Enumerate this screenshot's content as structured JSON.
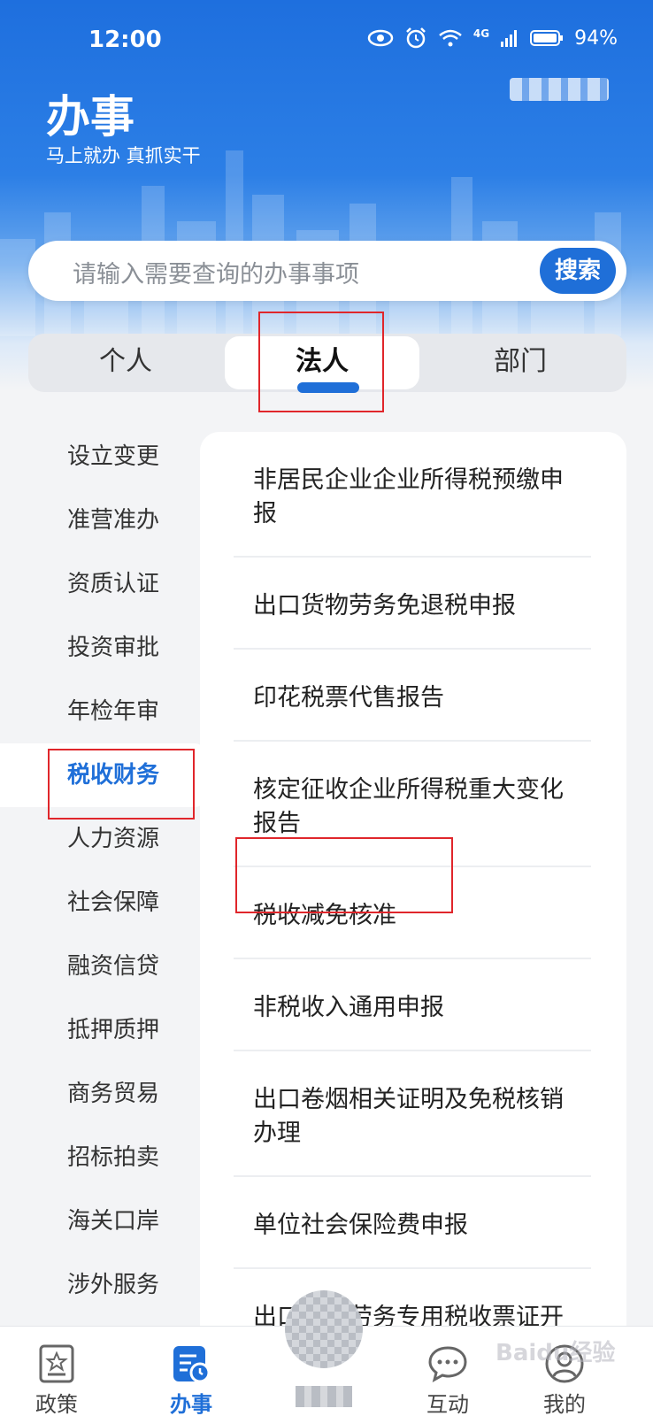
{
  "status_bar": {
    "time": "12:00",
    "network": "4G",
    "battery": "94%"
  },
  "header": {
    "title": "办事",
    "slogan": "马上就办  真抓实干"
  },
  "search": {
    "placeholder": "请输入需要查询的办事事项",
    "button_label": "搜索"
  },
  "tabs": [
    {
      "label": "个人",
      "active": false
    },
    {
      "label": "法人",
      "active": true
    },
    {
      "label": "部门",
      "active": false
    }
  ],
  "categories": [
    {
      "label": "设立变更"
    },
    {
      "label": "准营准办"
    },
    {
      "label": "资质认证"
    },
    {
      "label": "投资审批"
    },
    {
      "label": "年检年审"
    },
    {
      "label": "税收财务",
      "active": true
    },
    {
      "label": "人力资源"
    },
    {
      "label": "社会保障"
    },
    {
      "label": "融资信贷"
    },
    {
      "label": "抵押质押"
    },
    {
      "label": "商务贸易"
    },
    {
      "label": "招标拍卖"
    },
    {
      "label": "海关口岸"
    },
    {
      "label": "涉外服务"
    }
  ],
  "services": [
    {
      "label": "非居民企业企业所得税预缴申报"
    },
    {
      "label": "出口货物劳务免退税申报"
    },
    {
      "label": "印花税票代售报告"
    },
    {
      "label": "核定征收企业所得税重大变化报告"
    },
    {
      "label": "税收减免核准"
    },
    {
      "label": "非税收入通用申报"
    },
    {
      "label": "出口卷烟相关证明及免税核销办理"
    },
    {
      "label": "单位社会保险费申报"
    },
    {
      "label": "出口货物劳务专用税收票证开具"
    }
  ],
  "tabbar": {
    "items": [
      {
        "label": "政策"
      },
      {
        "label": "办事",
        "active": true
      },
      {
        "label": "互动"
      },
      {
        "label": "我的"
      }
    ]
  },
  "watermark": "Baidu经验",
  "colors": {
    "primary": "#1f6fd8",
    "highlight": "#e0262b"
  }
}
